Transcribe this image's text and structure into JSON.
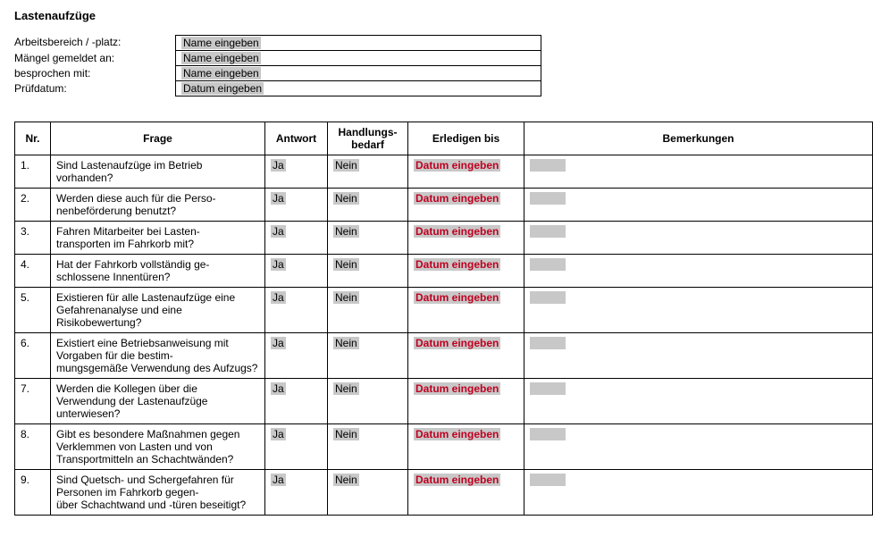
{
  "title": "Lastenaufzüge",
  "meta": {
    "labels": {
      "area": "Arbeitsbereich / -platz:",
      "reported": "Mängel gemeldet an:",
      "discussed": "besprochen mit:",
      "date": "Prüfdatum:"
    },
    "placeholders": {
      "name": "Name eingeben",
      "date": "Datum eingeben"
    }
  },
  "headers": {
    "nr": "Nr.",
    "frage": "Frage",
    "antwort": "Antwort",
    "handlung": "Handlungs-\nbedarf",
    "erledigen": "Erledigen bis",
    "bemerkungen": "Bemerkungen"
  },
  "answer": {
    "ja": "Ja",
    "nein": "Nein"
  },
  "date_placeholder": "Datum eingeben",
  "rows": [
    {
      "nr": "1.",
      "q": "Sind Lastenaufzüge im Betrieb vorhanden?"
    },
    {
      "nr": "2.",
      "q": "Werden diese auch für die Perso-\nnenbeförderung benutzt?"
    },
    {
      "nr": "3.",
      "q": "Fahren Mitarbeiter bei Lasten-\ntransporten im Fahrkorb mit?"
    },
    {
      "nr": "4.",
      "q": "Hat der Fahrkorb vollständig ge-\nschlossene Innentüren?"
    },
    {
      "nr": "5.",
      "q": "Existieren für alle Lastenaufzüge eine Gefahrenanalyse und eine Risikobewertung?"
    },
    {
      "nr": "6.",
      "q": "Existiert eine Betriebsanweisung mit Vorgaben für die bestim-\nmungsgemäße Verwendung des Aufzugs?"
    },
    {
      "nr": "7.",
      "q": "Werden die Kollegen über die Verwendung der Lastenaufzüge unterwiesen?"
    },
    {
      "nr": "8.",
      "q": "Gibt es besondere Maßnahmen gegen Verklemmen von Lasten und von Transportmitteln an Schachtwänden?"
    },
    {
      "nr": "9.",
      "q": "Sind Quetsch- und Schergefahren für Personen im Fahrkorb gegen-\nüber Schachtwand und -türen beseitigt?"
    }
  ]
}
